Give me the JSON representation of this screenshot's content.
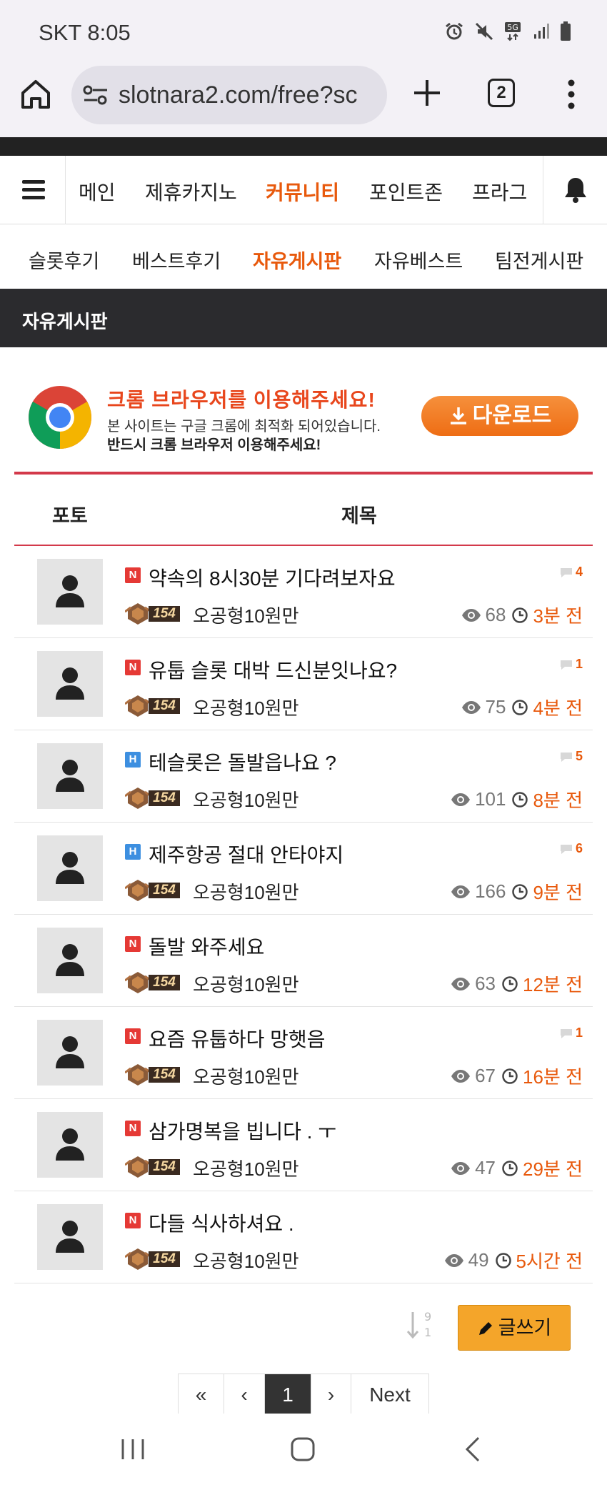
{
  "status": {
    "carrier": "SKT",
    "time": "8:05",
    "network": "5G"
  },
  "browser": {
    "url": "slotnara2.com/free?sc",
    "tab_count": "2"
  },
  "top_nav": {
    "items": [
      {
        "label": "메인",
        "active": false
      },
      {
        "label": "제휴카지노",
        "active": false
      },
      {
        "label": "커뮤니티",
        "active": true
      },
      {
        "label": "포인트존",
        "active": false
      },
      {
        "label": "프라그",
        "active": false
      }
    ]
  },
  "sub_nav": {
    "items": [
      {
        "label": "슬롯후기",
        "active": false
      },
      {
        "label": "베스트후기",
        "active": false
      },
      {
        "label": "자유게시판",
        "active": true
      },
      {
        "label": "자유베스트",
        "active": false
      },
      {
        "label": "팀전게시판",
        "active": false
      }
    ]
  },
  "board_title": "자유게시판",
  "banner": {
    "title": "크롬 브라우저를 이용해주세요!",
    "line1": "본 사이트는 구글 크롬에 최적화 되어있습니다.",
    "line2": "반드시 크롬 브라우저 이용해주세요!",
    "download_label": "다운로드"
  },
  "list_header": {
    "photo": "포토",
    "title": "제목"
  },
  "posts": [
    {
      "badge": "N",
      "title": "약속의 8시30분 기다려보자요",
      "comments": "4",
      "level": "154",
      "author": "오공형10원만",
      "views": "68",
      "time": "3분 전"
    },
    {
      "badge": "N",
      "title": "유툽 슬롯 대박 드신분잇나요?",
      "comments": "1",
      "level": "154",
      "author": "오공형10원만",
      "views": "75",
      "time": "4분 전"
    },
    {
      "badge": "H",
      "title": "테슬롯은 돌발읍나요 ?",
      "comments": "5",
      "level": "154",
      "author": "오공형10원만",
      "views": "101",
      "time": "8분 전"
    },
    {
      "badge": "H",
      "title": "제주항공 절대 안타야지",
      "comments": "6",
      "level": "154",
      "author": "오공형10원만",
      "views": "166",
      "time": "9분 전"
    },
    {
      "badge": "N",
      "title": "돌발 와주세요",
      "comments": "",
      "level": "154",
      "author": "오공형10원만",
      "views": "63",
      "time": "12분 전"
    },
    {
      "badge": "N",
      "title": "요즘 유툽하다 망햇음",
      "comments": "1",
      "level": "154",
      "author": "오공형10원만",
      "views": "67",
      "time": "16분 전"
    },
    {
      "badge": "N",
      "title": "삼가명복을 빕니다 . ㅜ",
      "comments": "",
      "level": "154",
      "author": "오공형10원만",
      "views": "47",
      "time": "29분 전"
    },
    {
      "badge": "N",
      "title": "다들 식사하셔요 .",
      "comments": "",
      "level": "154",
      "author": "오공형10원만",
      "views": "49",
      "time": "5시간 전"
    }
  ],
  "sort_icon_digits": {
    "top": "9",
    "bottom": "1"
  },
  "write_label": "글쓰기",
  "pagination": {
    "first": "«",
    "prev": "‹",
    "current": "1",
    "next_arrow": "›",
    "next_label": "Next"
  },
  "colors": {
    "accent": "#e8590c",
    "rule": "#d3394a",
    "write_button": "#f4a52a",
    "header_dark": "#2b2b2e"
  }
}
